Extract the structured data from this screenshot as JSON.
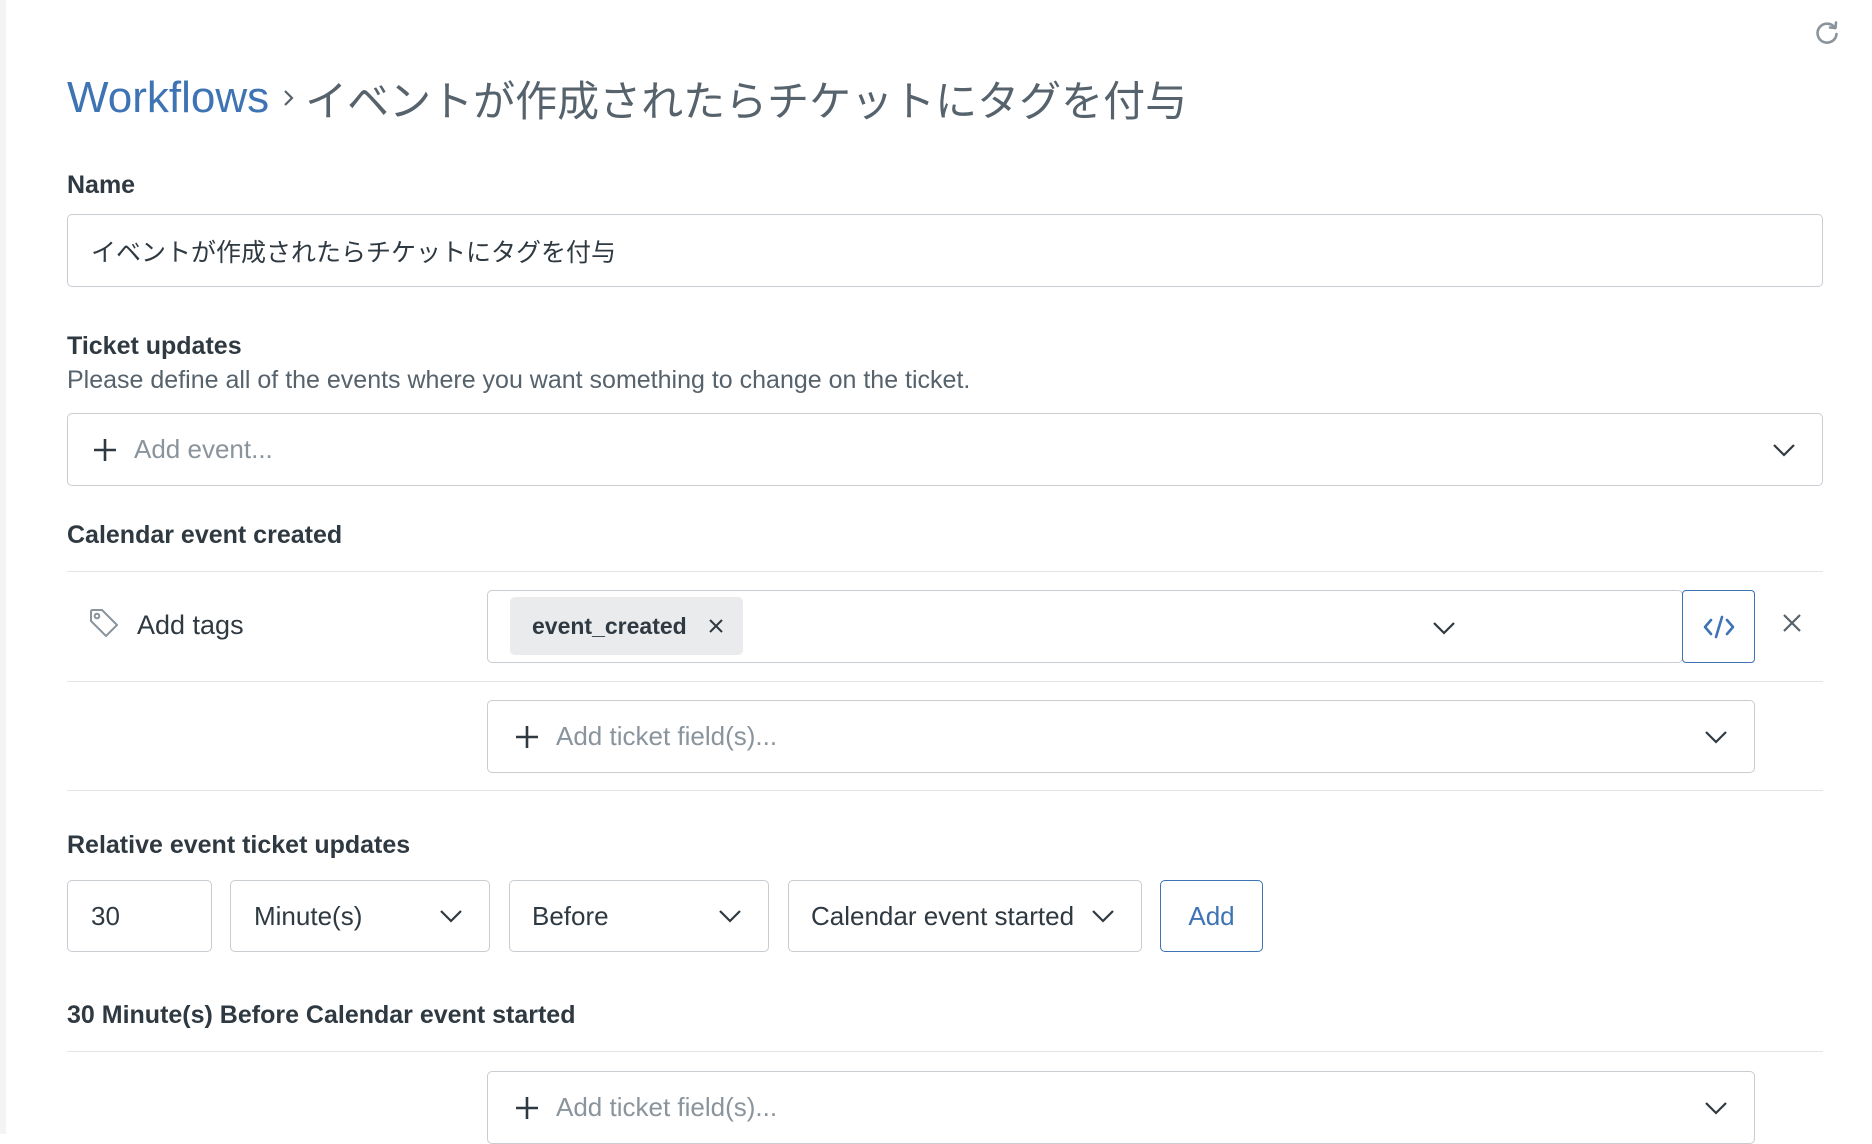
{
  "breadcrumb": {
    "root": "Workflows",
    "current": "イベントが作成されたらチケットにタグを付与"
  },
  "name_section": {
    "label": "Name",
    "value": "イベントが作成されたらチケットにタグを付与"
  },
  "ticket_updates": {
    "label": "Ticket updates",
    "hint": "Please define all of the events where you want something to change on the ticket.",
    "add_event_placeholder": "Add event..."
  },
  "calendar_event_created": {
    "label": "Calendar event created",
    "action_label": "Add tags",
    "tags": [
      "event_created"
    ],
    "add_field_placeholder": "Add ticket field(s)..."
  },
  "relative_updates": {
    "label": "Relative event ticket updates",
    "amount": "30",
    "unit": "Minute(s)",
    "direction": "Before",
    "event": "Calendar event started",
    "add_button": "Add"
  },
  "relative_group": {
    "label": "30 Minute(s) Before Calendar event started",
    "add_field_placeholder": "Add ticket field(s)..."
  },
  "icons": [
    "refresh-icon",
    "chevron-right-icon",
    "plus-icon",
    "chevron-down-icon",
    "tag-icon",
    "close-icon",
    "code-icon"
  ],
  "colors": {
    "link": "#3e73b4",
    "text": "#2f3941",
    "muted": "#56626c",
    "border": "#c8cdd2",
    "chip": "#e9ebed"
  }
}
